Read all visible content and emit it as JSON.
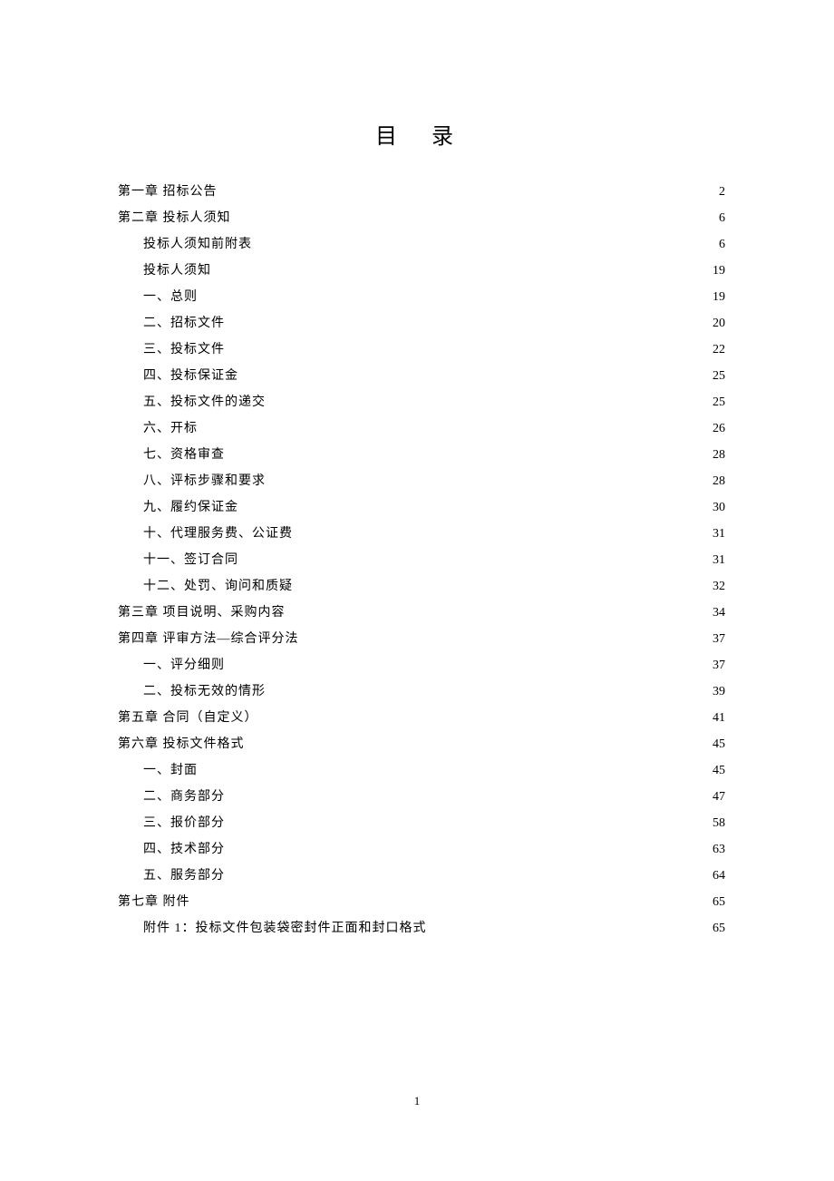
{
  "title": "目 录",
  "page_number": "1",
  "toc": [
    {
      "level": 0,
      "label": "第一章  招标公告",
      "page": "2"
    },
    {
      "level": 0,
      "label": "第二章 投标人须知",
      "page": "6"
    },
    {
      "level": 1,
      "label": "投标人须知前附表",
      "page": "6"
    },
    {
      "level": 1,
      "label": "投标人须知",
      "page": "19"
    },
    {
      "level": 1,
      "label": "一、总则",
      "page": "19"
    },
    {
      "level": 1,
      "label": "二、招标文件",
      "page": "20"
    },
    {
      "level": 1,
      "label": "三、投标文件",
      "page": "22"
    },
    {
      "level": 1,
      "label": "四、投标保证金",
      "page": "25"
    },
    {
      "level": 1,
      "label": "五、投标文件的递交",
      "page": "25"
    },
    {
      "level": 1,
      "label": "六、开标",
      "page": "26"
    },
    {
      "level": 1,
      "label": "七、资格审查",
      "page": "28"
    },
    {
      "level": 1,
      "label": "八、评标步骤和要求",
      "page": "28"
    },
    {
      "level": 1,
      "label": "九、履约保证金",
      "page": "30"
    },
    {
      "level": 1,
      "label": "十、代理服务费、公证费",
      "page": "31"
    },
    {
      "level": 1,
      "label": "十一、签订合同",
      "page": "31"
    },
    {
      "level": 1,
      "label": "十二、处罚、询问和质疑",
      "page": "32"
    },
    {
      "level": 0,
      "label": "第三章  项目说明、采购内容",
      "page": "34"
    },
    {
      "level": 0,
      "label": "第四章  评审方法—综合评分法",
      "page": "37"
    },
    {
      "level": 1,
      "label": "一、评分细则",
      "page": "37"
    },
    {
      "level": 1,
      "label": "二、投标无效的情形",
      "page": "39"
    },
    {
      "level": 0,
      "label": "第五章 合同（自定义）",
      "page": "41"
    },
    {
      "level": 0,
      "label": "第六章 投标文件格式",
      "page": "45"
    },
    {
      "level": 1,
      "label": "一、封面",
      "page": "45"
    },
    {
      "level": 1,
      "label": "二、商务部分",
      "page": "47"
    },
    {
      "level": 1,
      "label": "三、报价部分",
      "page": "58"
    },
    {
      "level": 1,
      "label": "四、技术部分",
      "page": "63"
    },
    {
      "level": 1,
      "label": "五、服务部分",
      "page": "64"
    },
    {
      "level": 0,
      "label": "第七章  附件",
      "page": "65"
    },
    {
      "level": 1,
      "label": "附件 1：投标文件包装袋密封件正面和封口格式",
      "page": "65"
    }
  ]
}
